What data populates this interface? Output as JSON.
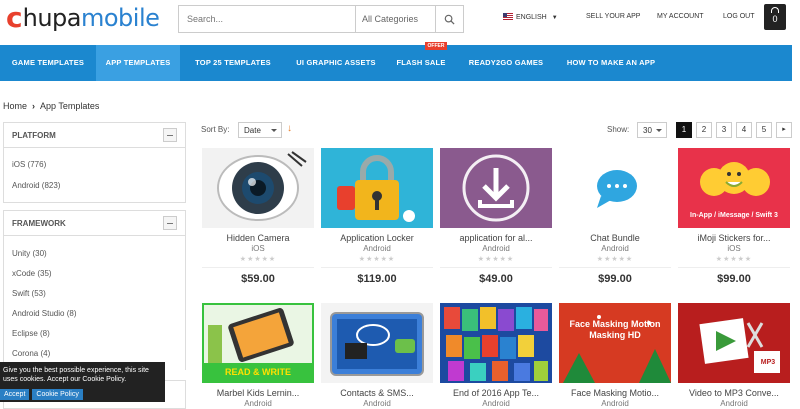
{
  "header": {
    "logo_c": "c",
    "logo_hupa": "hupa",
    "logo_mobile": "mobile",
    "search_placeholder": "Search...",
    "category_select": "All Categories",
    "language": "ENGLISH",
    "sell_link": "SELL YOUR APP",
    "account_link": "MY ACCOUNT",
    "logout_link": "LOG OUT",
    "cart_count": "0"
  },
  "nav": {
    "items": [
      "GAME TEMPLATES",
      "APP TEMPLATES",
      "TOP 25 TEMPLATES",
      "UI GRAPHIC ASSETS",
      "FLASH SALE",
      "READY2GO GAMES",
      "HOW TO MAKE AN APP"
    ],
    "offer_badge": "OFFER"
  },
  "breadcrumb": {
    "home": "Home",
    "current": "App Templates"
  },
  "sidebar": {
    "platform_title": "PLATFORM",
    "platform_items": [
      "iOS (776)",
      "Android (823)"
    ],
    "framework_title": "FRAMEWORK",
    "framework_items": [
      "Unity (30)",
      "xCode (35)",
      "Swift (53)",
      "Android Studio (8)",
      "Eclipse (8)",
      "Corona (4)"
    ]
  },
  "sort": {
    "label": "Sort By:",
    "value": "Date",
    "show_label": "Show:",
    "show_value": "30",
    "pages": [
      "1",
      "2",
      "3",
      "4",
      "5"
    ]
  },
  "products": [
    {
      "name": "Hidden Camera",
      "platform": "iOS",
      "price": "$59.00"
    },
    {
      "name": "Application Locker",
      "platform": "Android",
      "price": "$119.00"
    },
    {
      "name": "application for al...",
      "platform": "Android",
      "price": "$49.00"
    },
    {
      "name": "Chat Bundle",
      "platform": "Android",
      "price": "$99.00"
    },
    {
      "name": "iMoji Stickers for...",
      "platform": "iOS",
      "price": "$99.00"
    },
    {
      "name": "Marbel Kids Lernin...",
      "platform": "Android",
      "price": ""
    },
    {
      "name": "Contacts & SMS...",
      "platform": "Android",
      "price": ""
    },
    {
      "name": "End of 2016 App Te...",
      "platform": "Android",
      "price": ""
    },
    {
      "name": "Face Masking Motio...",
      "platform": "Android",
      "price": ""
    },
    {
      "name": "Video to MP3 Conve...",
      "platform": "Android",
      "price": ""
    }
  ],
  "thumb_text": {
    "imoji": "In-App / iMessage / Swift 3",
    "read_write": "READ & WRITE",
    "face_mask": "Face Masking Motion Masking HD",
    "mp3": "MP3"
  },
  "cookie": {
    "text": "Give you the best possible experience, this site uses cookies. Accept our Cookie Policy.",
    "accept": "Accept",
    "policy": "Cookie Policy"
  },
  "colors": {
    "nav": "#1b88cf",
    "nav_active": "#3aa0e2",
    "accent": "#e8402d"
  }
}
